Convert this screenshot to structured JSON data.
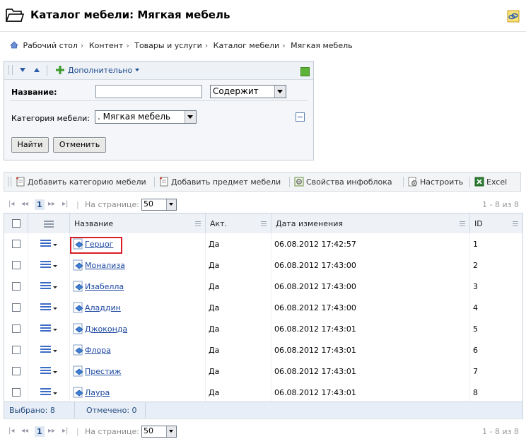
{
  "header": {
    "title": "Каталог мебели: Мягкая мебель"
  },
  "breadcrumb": [
    "Рабочий стол",
    "Контент",
    "Товары и услуги",
    "Каталог мебели",
    "Мягкая мебель"
  ],
  "filter": {
    "more_label": "Дополнительно",
    "name_label": "Название:",
    "name_value": "",
    "name_mode": "Содержит",
    "category_label": "Категория мебели:",
    "category_value": ". Мягкая мебель",
    "find_label": "Найти",
    "cancel_label": "Отменить"
  },
  "toolbar": {
    "add_category": "Добавить категорию мебели",
    "add_item": "Добавить предмет мебели",
    "iblock_props": "Свойства инфоблока",
    "configure": "Настроить",
    "excel": "Excel"
  },
  "pager": {
    "current_page": "1",
    "per_page_label": "На странице:",
    "per_page_value": "50",
    "count": "1 - 8 из 8"
  },
  "table": {
    "columns": [
      "Название",
      "Акт.",
      "Дата изменения",
      "ID"
    ],
    "rows": [
      {
        "name": "Герцог",
        "active": "Да",
        "modified": "06.08.2012 17:42:57",
        "id": "1"
      },
      {
        "name": "Монализа",
        "active": "Да",
        "modified": "06.08.2012 17:43:00",
        "id": "2"
      },
      {
        "name": "Изабелла",
        "active": "Да",
        "modified": "06.08.2012 17:43:00",
        "id": "3"
      },
      {
        "name": "Аладдин",
        "active": "Да",
        "modified": "06.08.2012 17:43:00",
        "id": "4"
      },
      {
        "name": "Джоконда",
        "active": "Да",
        "modified": "06.08.2012 17:43:01",
        "id": "5"
      },
      {
        "name": "Флора",
        "active": "Да",
        "modified": "06.08.2012 17:43:01",
        "id": "6"
      },
      {
        "name": "Престиж",
        "active": "Да",
        "modified": "06.08.2012 17:43:01",
        "id": "7"
      },
      {
        "name": "Лаура",
        "active": "Да",
        "modified": "06.08.2012 17:43:01",
        "id": "8"
      }
    ],
    "footer": {
      "selected": "Выбрано: 8",
      "checked": "Отмечено: 0"
    }
  },
  "colors": {
    "link": "#1a46a0",
    "highlight": "#d81f26",
    "accent": "#2c5ca8"
  }
}
